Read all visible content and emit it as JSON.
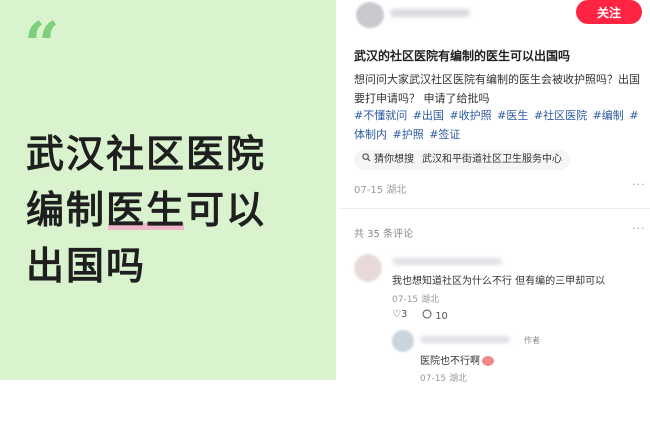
{
  "left_banner": {
    "quote_mark": "“",
    "title_line1": "武汉社区医院",
    "title_line2_before": "编制",
    "title_line2_highlight": "医生",
    "title_line2_after": "可以",
    "title_line3": "出国吗"
  },
  "post": {
    "follow_label": "关注",
    "title": "武汉的社区医院有编制的医生可以出国吗",
    "body": "想问问大家武汉社区医院有编制的医生会被收护照吗？出国要打申请吗？ 申请了给批吗",
    "tags": [
      "#不懂就问",
      "#出国",
      "#收护照",
      "#医生",
      "#社区医院",
      "#编制",
      "#体制内",
      "#护照",
      "#签证"
    ],
    "suggest_label": "猜你想搜",
    "suggest_query": "武汉和平街道社区卫生服务中心",
    "date": "07-15",
    "location": "湖北",
    "more": "···"
  },
  "comments": {
    "count_label": "共 35 条评论",
    "items": [
      {
        "text": "我也想知道社区为什么不行 但有编的三甲却可以",
        "date": "07-15",
        "location": "湖北",
        "likes": "3",
        "replies": "10"
      }
    ],
    "reply": {
      "badge": "作者",
      "text": "医院也不行啊",
      "date": "07-15",
      "location": "湖北"
    }
  },
  "colors": {
    "banner_bg": "#d9f3cf",
    "follow_btn": "#ff2442",
    "tag": "#2c5aa0",
    "highlight": "#f4a6c8"
  }
}
